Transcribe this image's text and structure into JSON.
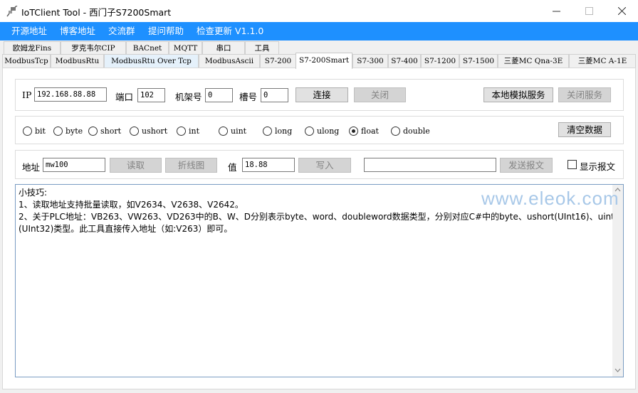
{
  "window": {
    "title": "IoTClient Tool - 西门子S7200Smart",
    "icon": "network-plug-icon",
    "controls": [
      "minimize",
      "maximize",
      "close"
    ]
  },
  "menu": [
    "开源地址",
    "博客地址",
    "交流群",
    "提问帮助",
    "检查更新 V1.1.0"
  ],
  "tabs_row1": [
    "欧姆龙Fins",
    "罗克韦尔CIP",
    "BACnet",
    "MQTT",
    "串口",
    "工具"
  ],
  "tabs_row2": [
    "ModbusTcp",
    "ModbusRtu",
    "ModbusRtu Over Tcp",
    "ModbusAscii",
    "S7-200",
    "S7-200Smart",
    "S7-300",
    "S7-400",
    "S7-1200",
    "S7-1500",
    "三菱MC Qna-3E",
    "三菱MC A-1E"
  ],
  "active_tab": "S7-200Smart",
  "connection": {
    "ip_label": "IP",
    "ip_value": "192.168.88.88",
    "port_label": "端口",
    "port_value": "102",
    "rack_label": "机架号",
    "rack_value": "0",
    "slot_label": "槽号",
    "slot_value": "0",
    "connect_label": "连接",
    "close_label": "关闭",
    "sim_service_label": "本地模拟服务",
    "close_service_label": "关闭服务"
  },
  "datatypes": {
    "options": [
      "bit",
      "byte",
      "short",
      "ushort",
      "int",
      "uint",
      "long",
      "ulong",
      "float",
      "double"
    ],
    "selected": "float",
    "clear_label": "清空数据"
  },
  "rw": {
    "address_label": "地址",
    "address_value": "mw100",
    "read_label": "读取",
    "chart_label": "折线图",
    "value_label": "值",
    "value_value": "18.88",
    "write_label": "写入",
    "message_value": "",
    "send_label": "发送报文",
    "show_message_label": "显示报文",
    "show_message_checked": false
  },
  "log": {
    "lines": [
      "小技巧:",
      "1、读取地址支持批量读取，如V2634、V2638、V2642。",
      "2、关于PLC地址：VB263、VW263、VD263中的B、W、D分别表示byte、word、doubleword数据类型，分别对应C#中的byte、ushort(UInt16)、uint",
      "(UInt32)类型。此工具直接传入地址（如:V263）即可。"
    ]
  },
  "watermark": "www.eleok.com",
  "colors": {
    "menubar": "#1e90ff",
    "watermark": "#a8c8e8"
  }
}
